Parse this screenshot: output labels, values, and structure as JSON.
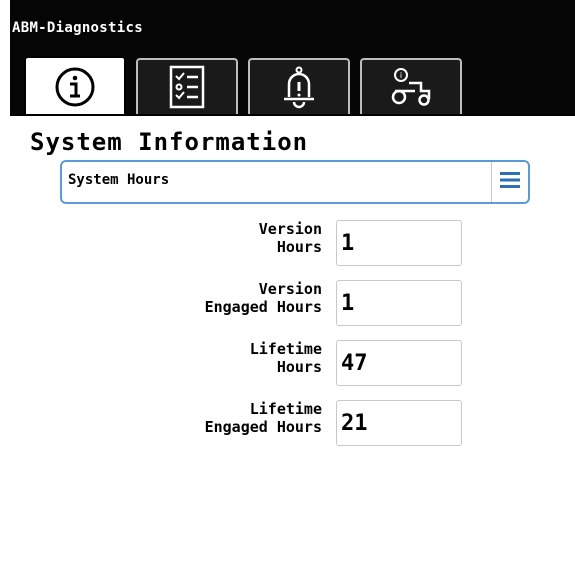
{
  "window": {
    "title": "ABM-Diagnostics"
  },
  "tabs": [
    {
      "icon": "info-icon",
      "active": true
    },
    {
      "icon": "checklist-icon",
      "active": false
    },
    {
      "icon": "alarm-bell-icon",
      "active": false
    },
    {
      "icon": "tractor-icon",
      "active": false
    }
  ],
  "section": {
    "title": "System Information"
  },
  "dropdown": {
    "selected": "System Hours",
    "icon": "hamburger-menu-icon",
    "accent": "#5a9bd5"
  },
  "rows": [
    {
      "label_line1": "Version",
      "label_line2": "Hours",
      "value": "1"
    },
    {
      "label_line1": "Version",
      "label_line2": "Engaged Hours",
      "value": "1"
    },
    {
      "label_line1": "Lifetime",
      "label_line2": "Hours",
      "value": "47"
    },
    {
      "label_line1": "Lifetime",
      "label_line2": "Engaged Hours",
      "value": "21"
    }
  ]
}
